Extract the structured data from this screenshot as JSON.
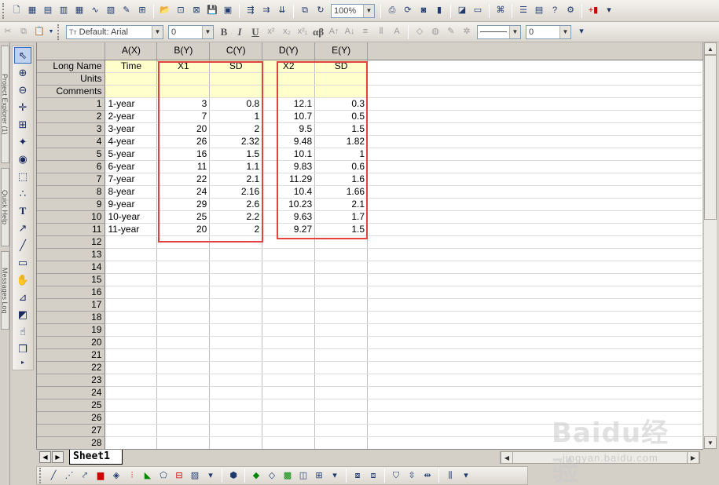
{
  "toolbar": {
    "zoom": "100%",
    "font_name": "Default: Arial",
    "font_size": "0",
    "line_width": "0",
    "bold_label": "B",
    "italic_label": "I",
    "underline_label": "U",
    "greek_label": "αβ"
  },
  "left_tabs": [
    "Project Explorer (1)",
    "Quick Help",
    "Messages Log"
  ],
  "sheet": {
    "tab_name": "Sheet1",
    "columns": [
      {
        "header": "A(X)",
        "long_name": "Time",
        "units": "",
        "comments": ""
      },
      {
        "header": "B(Y)",
        "long_name": "X1",
        "units": "",
        "comments": ""
      },
      {
        "header": "C(Y)",
        "long_name": "SD",
        "units": "",
        "comments": ""
      },
      {
        "header": "D(Y)",
        "long_name": "X2",
        "units": "",
        "comments": ""
      },
      {
        "header": "E(Y)",
        "long_name": "SD",
        "units": "",
        "comments": ""
      }
    ],
    "meta_labels": [
      "Long Name",
      "Units",
      "Comments"
    ],
    "rows": [
      [
        "1-year",
        "3",
        "0.8",
        "12.1",
        "0.3"
      ],
      [
        "2-year",
        "7",
        "1",
        "10.7",
        "0.5"
      ],
      [
        "3-year",
        "20",
        "2",
        "9.5",
        "1.5"
      ],
      [
        "4-year",
        "26",
        "2.32",
        "9.48",
        "1.82"
      ],
      [
        "5-year",
        "16",
        "1.5",
        "10.1",
        "1"
      ],
      [
        "6-year",
        "11",
        "1.1",
        "9.83",
        "0.6"
      ],
      [
        "7-year",
        "22",
        "2.1",
        "11.29",
        "1.6"
      ],
      [
        "8-year",
        "24",
        "2.16",
        "10.4",
        "1.66"
      ],
      [
        "9-year",
        "29",
        "2.6",
        "10.23",
        "2.1"
      ],
      [
        "10-year",
        "25",
        "2.2",
        "9.63",
        "1.7"
      ],
      [
        "11-year",
        "20",
        "2",
        "9.27",
        "1.5"
      ]
    ],
    "row_count": 28
  },
  "watermark": {
    "logo": "Baidu经验",
    "url": "jingyan.baidu.com"
  }
}
